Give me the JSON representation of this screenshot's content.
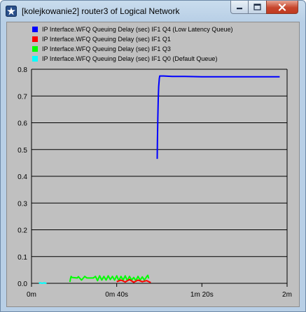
{
  "window": {
    "title": "[kolejkowanie2] router3 of Logical Network",
    "icons": {
      "app": "star-icon",
      "minimize": "minimize-icon",
      "maximize": "maximize-icon",
      "close": "close-icon"
    }
  },
  "chart_data": {
    "type": "line",
    "background": "#c0c0c0",
    "grid": "horizontal",
    "legend_position": "top-left",
    "xlim": [
      0,
      120
    ],
    "ylim": [
      0,
      0.8
    ],
    "x_ticks": [
      {
        "value": 0,
        "label": "0m"
      },
      {
        "value": 40,
        "label": "0m 40s"
      },
      {
        "value": 80,
        "label": "1m 20s"
      },
      {
        "value": 120,
        "label": "2m"
      }
    ],
    "y_ticks": [
      {
        "value": 0.0,
        "label": "0.0"
      },
      {
        "value": 0.1,
        "label": "0.1"
      },
      {
        "value": 0.2,
        "label": "0.2"
      },
      {
        "value": 0.3,
        "label": "0.3"
      },
      {
        "value": 0.4,
        "label": "0.4"
      },
      {
        "value": 0.5,
        "label": "0.5"
      },
      {
        "value": 0.6,
        "label": "0.6"
      },
      {
        "value": 0.7,
        "label": "0.7"
      },
      {
        "value": 0.8,
        "label": "0.8"
      }
    ],
    "series": [
      {
        "name": "IP Interface.WFQ Queuing Delay (sec) IF1 Q4 (Low Latency Queue)",
        "color": "#0000ff",
        "x": [
          59.0,
          59.1,
          59.3,
          59.5,
          59.7,
          60.0,
          60.2,
          62.0,
          66.0,
          72.0,
          80.0,
          90.0,
          100.0,
          110.0,
          116.5
        ],
        "y": [
          0.465,
          0.53,
          0.62,
          0.69,
          0.735,
          0.765,
          0.775,
          0.775,
          0.773,
          0.773,
          0.772,
          0.772,
          0.772,
          0.772,
          0.772
        ]
      },
      {
        "name": "IP Interface.WFQ Queuing Delay (sec) IF1 Q1",
        "color": "#ff0000",
        "x": [
          40.0,
          42.0,
          44.0,
          46.0,
          48.0,
          50.0,
          52.0,
          54.0,
          56.0
        ],
        "y": [
          0.006,
          0.012,
          0.005,
          0.014,
          0.004,
          0.012,
          0.006,
          0.01,
          0.003
        ]
      },
      {
        "name": "IP Interface.WFQ Queuing Delay (sec) IF1 Q3",
        "color": "#00ff00",
        "x": [
          18.0,
          18.3,
          18.6,
          19.0,
          21.5,
          22.0,
          23.5,
          25.0,
          26.0,
          29.0,
          30.0,
          31.0,
          32.0,
          33.0,
          34.0,
          35.0,
          36.0,
          37.0,
          38.0,
          39.0,
          40.0,
          41.0,
          42.0,
          43.0,
          44.0,
          45.0,
          46.0,
          47.0,
          48.0,
          49.0,
          50.0,
          51.0,
          52.0,
          53.0,
          54.0,
          54.6,
          55.0
        ],
        "y": [
          0.005,
          0.018,
          0.026,
          0.022,
          0.02,
          0.025,
          0.012,
          0.026,
          0.02,
          0.02,
          0.026,
          0.01,
          0.028,
          0.012,
          0.026,
          0.012,
          0.028,
          0.014,
          0.026,
          0.012,
          0.028,
          0.01,
          0.026,
          0.012,
          0.028,
          0.01,
          0.026,
          0.012,
          0.022,
          0.01,
          0.026,
          0.012,
          0.024,
          0.012,
          0.024,
          0.03,
          0.018
        ]
      },
      {
        "name": "IP Interface.WFQ Queuing Delay (sec) IF1 Q0 (Default Queue)",
        "color": "#00ffff",
        "x": [
          3.5,
          4.0,
          5.0,
          6.0,
          6.5,
          7.0
        ],
        "y": [
          0.0,
          0.002,
          0.0,
          0.002,
          0.0,
          0.002
        ]
      }
    ]
  }
}
